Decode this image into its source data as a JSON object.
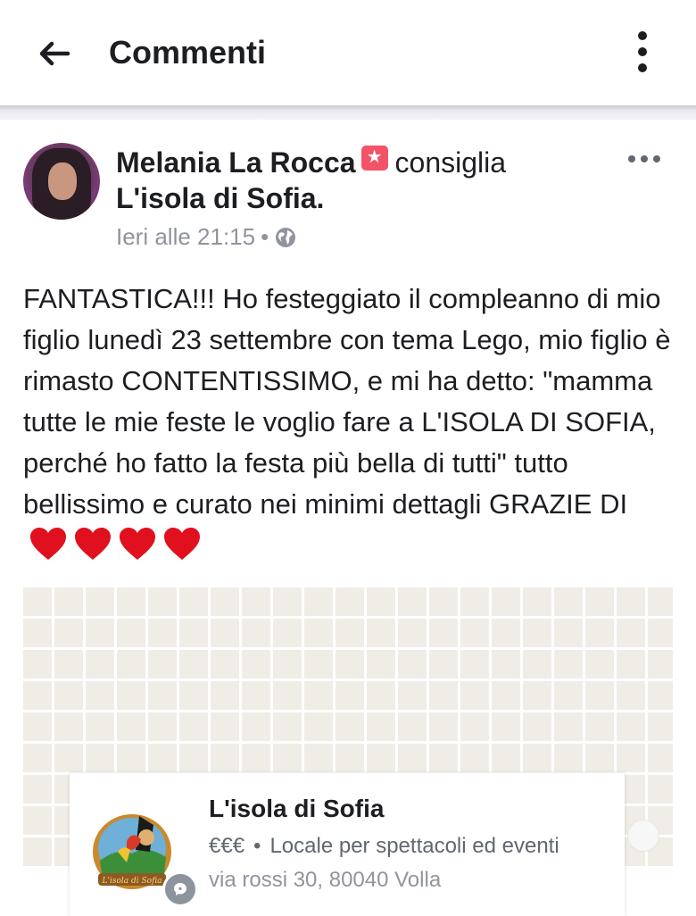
{
  "header": {
    "title": "Commenti",
    "back_icon": "arrow-left-icon",
    "menu_icon": "more-vertical-icon"
  },
  "post": {
    "author": "Melania La Rocca",
    "verb": "consiglia",
    "page": "L'isola di Sofia.",
    "timestamp": "Ieri alle 21:15",
    "separator": "•",
    "privacy_icon": "globe-icon",
    "text": "FANTASTICA!!! Ho festeggiato il compleanno di mio figlio lunedì 23 settembre con tema Lego, mio figlio è rimasto CONTENTISSIMO, e mi ha detto: \"mamma tutte le mie feste le voglio fare a L'ISOLA DI SOFIA, perché ho fatto la festa più bella di tutti\" tutto bellissimo e curato nei minimi dettagli GRAZIE DI",
    "heart_count": 4,
    "heart_color": "#e0101e"
  },
  "place": {
    "name": "L'isola di Sofia",
    "price": "€€€",
    "separator": "•",
    "category": "Locale per spettacoli ed eventi",
    "address": "via rossi 30, 80040 Volla",
    "logo_text": "L'isola di Sofia"
  },
  "colors": {
    "recommend_badge": "#f35369",
    "secondary_text": "#90949c",
    "map_background": "#efede6"
  }
}
